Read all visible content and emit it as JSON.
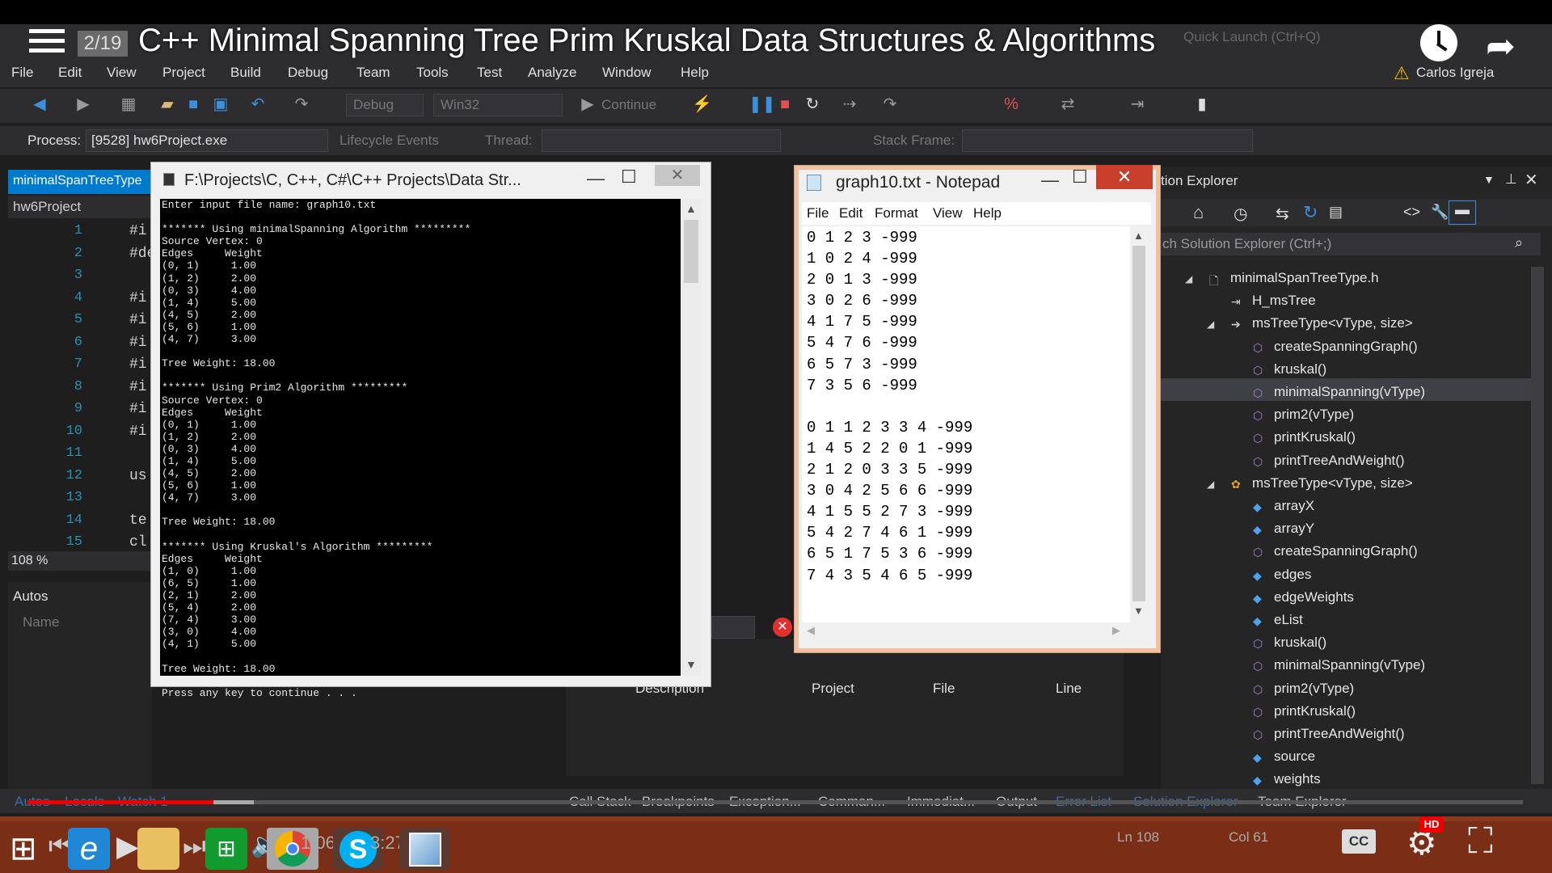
{
  "video": {
    "title": "C++ Minimal Spanning Tree Prim Kruskal Data Structures & Algorithms",
    "playlist_position": "2/19",
    "time_current": "1:06",
    "time_total": "3:27",
    "progress_fraction": 0.124,
    "cc_label": "CC",
    "hd_label": "HD"
  },
  "vs": {
    "quick_launch": "Quick Launch (Ctrl+Q)",
    "user": "Carlos Igreja",
    "menu": [
      "File",
      "Edit",
      "View",
      "Project",
      "Build",
      "Debug",
      "Team",
      "Tools",
      "Test",
      "Analyze",
      "Window",
      "Help"
    ],
    "toolbar": {
      "config": "Debug",
      "platform": "Win32",
      "continue": "Continue"
    },
    "debug_bar": {
      "process_label": "Process:",
      "process_value": "[9528] hw6Project.exe",
      "lifecycle": "Lifecycle Events",
      "thread_label": "Thread:",
      "stack_frame_label": "Stack Frame:"
    },
    "editor": {
      "tab": "minimalSpanTreeType",
      "nav": "hw6Project",
      "zoom": "108 %",
      "line_numbers": [
        "1",
        "2",
        "3",
        "4",
        "5",
        "6",
        "7",
        "8",
        "9",
        "10",
        "11",
        "12",
        "13",
        "14",
        "15"
      ],
      "code_fragments": [
        "#i",
        "#de",
        "",
        "#i",
        "#i",
        "#i",
        "#i",
        "#i",
        "#i",
        "#i",
        "",
        "us",
        "",
        "te",
        "cl"
      ]
    },
    "autos": {
      "title": "Autos",
      "name_col": "Name"
    },
    "error_list": {
      "columns": [
        "Description",
        "Project",
        "File",
        "Line"
      ]
    },
    "bottom_tabs": [
      "Autos",
      "Locals",
      "Watch 1",
      "Call Stack",
      "Breakpoints",
      "Exception...",
      "Comman...",
      "Immediat...",
      "Output",
      "Error List",
      "Solution Explorer",
      "Team Explorer"
    ],
    "status": {
      "ln": "Ln 108",
      "col": "Col 61"
    }
  },
  "console": {
    "title": "F:\\Projects\\C, C++,  C#\\C++ Projects\\Data Str...",
    "lines": [
      "Enter input file name: graph10.txt",
      "",
      "******* Using minimalSpanning Algorithm *********",
      "Source Vertex: 0",
      "Edges     Weight",
      "(0, 1)     1.00",
      "(1, 2)     2.00",
      "(0, 3)     4.00",
      "(1, 4)     5.00",
      "(4, 5)     2.00",
      "(5, 6)     1.00",
      "(4, 7)     3.00",
      "",
      "Tree Weight: 18.00",
      "",
      "******* Using Prim2 Algorithm *********",
      "Source Vertex: 0",
      "Edges     Weight",
      "(0, 1)     1.00",
      "(1, 2)     2.00",
      "(0, 3)     4.00",
      "(1, 4)     5.00",
      "(4, 5)     2.00",
      "(5, 6)     1.00",
      "(4, 7)     3.00",
      "",
      "Tree Weight: 18.00",
      "",
      "******* Using Kruskal's Algorithm *********",
      "Edges     Weight",
      "(1, 0)     1.00",
      "(6, 5)     1.00",
      "(2, 1)     2.00",
      "(5, 4)     2.00",
      "(7, 4)     3.00",
      "(3, 0)     4.00",
      "(4, 1)     5.00",
      "",
      "Tree Weight: 18.00",
      "",
      "Press any key to continue . . ."
    ]
  },
  "notepad": {
    "title": "graph10.txt - Notepad",
    "menu": [
      "File",
      "Edit",
      "Format",
      "View",
      "Help"
    ],
    "lines": [
      "0 1 2 3 -999",
      "1 0 2 4 -999",
      "2 0 1 3 -999",
      "3 0 2 6 -999",
      "4 1 7 5 -999",
      "5 4 7 6 -999",
      "6 5 7 3 -999",
      "7 3 5 6 -999",
      "",
      "0 1 1 2 3 3 4 -999",
      "1 4 5 2 2 0 1 -999",
      "2 1 2 0 3 3 5 -999",
      "3 0 4 2 5 6 6 -999",
      "4 1 5 5 2 7 3 -999",
      "5 4 2 7 4 6 1 -999",
      "6 5 1 7 5 3 6 -999",
      "7 4 3 5 4 6 5 -999"
    ]
  },
  "solution_explorer": {
    "title": "tion Explorer",
    "search_placeholder": "ch Solution Explorer (Ctrl+;)",
    "items": [
      {
        "label": "minimalSpanTreeType.h",
        "icon": "header-file-icon"
      },
      {
        "label": "H_msTree",
        "icon": "macro-icon"
      },
      {
        "label": "msTreeType<vType, size>",
        "icon": "class-icon"
      },
      {
        "label": "createSpanningGraph()",
        "icon": "method-icon"
      },
      {
        "label": "kruskal()",
        "icon": "method-icon"
      },
      {
        "label": "minimalSpanning(vType)",
        "icon": "method-icon"
      },
      {
        "label": "prim2(vType)",
        "icon": "method-icon"
      },
      {
        "label": "printKruskal()",
        "icon": "method-icon"
      },
      {
        "label": "printTreeAndWeight()",
        "icon": "method-icon"
      },
      {
        "label": "msTreeType<vType, size>",
        "icon": "class-icon"
      },
      {
        "label": "arrayX",
        "icon": "field-icon"
      },
      {
        "label": "arrayY",
        "icon": "field-icon"
      },
      {
        "label": "createSpanningGraph()",
        "icon": "method-icon"
      },
      {
        "label": "edges",
        "icon": "field-icon"
      },
      {
        "label": "edgeWeights",
        "icon": "field-icon"
      },
      {
        "label": "eList",
        "icon": "field-icon"
      },
      {
        "label": "kruskal()",
        "icon": "method-icon"
      },
      {
        "label": "minimalSpanning(vType)",
        "icon": "method-icon"
      },
      {
        "label": "prim2(vType)",
        "icon": "method-icon"
      },
      {
        "label": "printKruskal()",
        "icon": "method-icon"
      },
      {
        "label": "printTreeAndWeight()",
        "icon": "method-icon"
      },
      {
        "label": "source",
        "icon": "field-icon"
      },
      {
        "label": "weights",
        "icon": "field-icon"
      }
    ]
  },
  "colors": {
    "vs_bg": "#2d2d30",
    "accent": "#007acc",
    "yt_red": "#e00000",
    "notepad_close": "#c8402c"
  }
}
